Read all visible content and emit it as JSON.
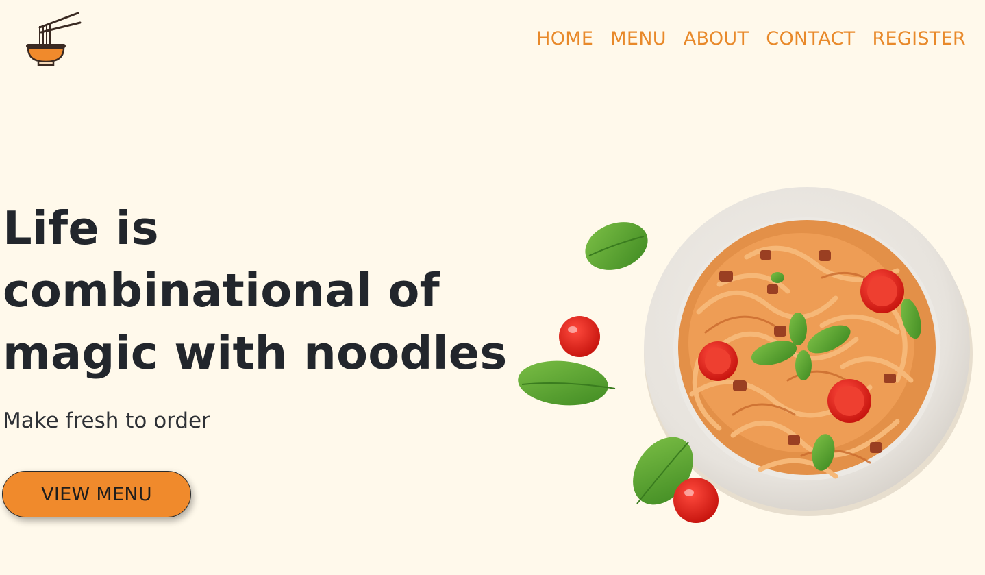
{
  "brand": {
    "logo_icon": "noodle-bowl-with-chopsticks-icon",
    "accent_color": "#e8892a"
  },
  "nav": {
    "items": [
      {
        "label": "HOME"
      },
      {
        "label": "MENU"
      },
      {
        "label": "ABOUT"
      },
      {
        "label": "CONTACT"
      },
      {
        "label": "REGISTER"
      }
    ]
  },
  "hero": {
    "title_lines": [
      "Life is",
      "combinational of",
      "magic with noodles"
    ],
    "subtitle": "Make fresh to order",
    "cta_label": "VIEW MENU",
    "cta_color": "#f08a2c",
    "background_color": "#fff9eb"
  },
  "image": {
    "icon": "pasta-plate-image"
  }
}
